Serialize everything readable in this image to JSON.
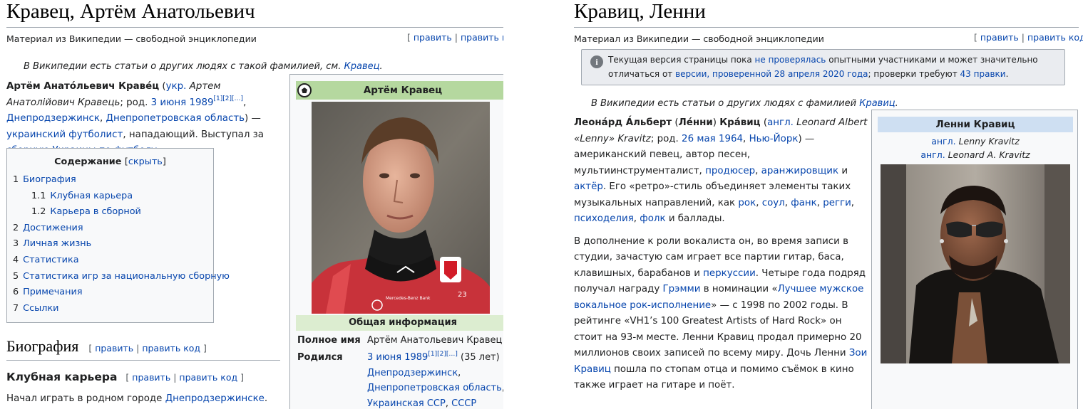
{
  "left": {
    "title": "Кравец, Артём Анатольевич",
    "site_sub": "Материал из Википедии — свободной энциклопедии",
    "edit": {
      "open": "[",
      "edit": "править",
      "sep": "|",
      "edit_code": "править код"
    },
    "hatnote": {
      "text": "В Википедии есть статьи о других людях с такой фамилией, см. ",
      "link": "Кравец",
      "end": "."
    },
    "lead": {
      "name_bold": "Артём Анато́льевич Краве́ц",
      "p1": " (",
      "lang_link": "укр.",
      "lang_native": " Артем Анатолійович Кравець",
      "p2": "; род. ",
      "date_link": "3 июня 1989",
      "refs": "[1][2][…]",
      "p3": ", ",
      "city_link": "Днепродзержинск",
      "p4": ", ",
      "region_link": "Днепропетровская область",
      "p5": ") — ",
      "occupation_link": "украинский футболист",
      "p6": ", нападающий. Выступал за ",
      "team_link": "сборную Украины по футболу",
      "p7": "."
    },
    "toc": {
      "title": "Содержание",
      "toggle_open": "[",
      "toggle": "скрыть",
      "toggle_close": "]",
      "items": [
        {
          "num": "1",
          "label": "Биография",
          "level": 1
        },
        {
          "num": "1.1",
          "label": "Клубная карьера",
          "level": 2
        },
        {
          "num": "1.2",
          "label": "Карьера в сборной",
          "level": 2
        },
        {
          "num": "2",
          "label": "Достижения",
          "level": 1
        },
        {
          "num": "3",
          "label": "Личная жизнь",
          "level": 1
        },
        {
          "num": "4",
          "label": "Статистика",
          "level": 1
        },
        {
          "num": "5",
          "label": "Статистика игр за национальную сборную",
          "level": 1
        },
        {
          "num": "6",
          "label": "Примечания",
          "level": 1
        },
        {
          "num": "7",
          "label": "Ссылки",
          "level": 1
        }
      ]
    },
    "h2": "Биография",
    "h3": "Клубная карьера",
    "section_edit": {
      "open": "[",
      "edit": "править",
      "sep": "|",
      "edit_code": "править код",
      "close": "]"
    },
    "body": {
      "text": "Начал играть в родном городе ",
      "link": "Днепродзержинске",
      "end": "."
    },
    "infobox": {
      "title": "Артём Кравец",
      "section": "Общая информация",
      "full_name_label": "Полное имя",
      "full_name_value": "Артём Анатольевич Кравец",
      "born_label": "Родился",
      "born_date": "3 июня 1989",
      "born_refs": "[1][2][…]",
      "born_age": " (35 лет)",
      "born_city": "Днепродзержинск",
      "born_region": "Днепропетровская область",
      "born_ssr": "Украинская ССР",
      "born_country": "СССР",
      "born_sep": ", ",
      "photo_sponsor": "Mercedes-Benz Bank",
      "photo_number": "23"
    }
  },
  "right": {
    "title": "Кравиц, Ленни",
    "site_sub": "Материал из Википедии — свободной энциклопедии",
    "edit": {
      "open": "[",
      "edit": "править",
      "sep": "|",
      "edit_code": "править код",
      "close": "]"
    },
    "notice": {
      "t1": "Текущая версия страницы пока ",
      "l1": "не проверялась",
      "t2": " опытными участниками и может значительно отличаться от ",
      "l2": "версии, проверенной 28 апреля 2020 года",
      "t3": "; проверки требуют ",
      "l3": "43 правки",
      "t4": "."
    },
    "hatnote": {
      "text": "В Википедии есть статьи о других людях с фамилией ",
      "link": "Кравиц",
      "end": "."
    },
    "lead": {
      "name_bold": "Леона́рд А́льберт",
      "nick_bold": "Ле́нни",
      "surname_bold": "Кра́виц",
      "lang_link": "англ.",
      "native": " Leonard Albert «Lenny» Kravitz",
      "born": "; род. ",
      "date_link": "26 мая 1964",
      "city_link": "Нью-Йорк",
      "t1": ") — американский певец, автор песен, мультиинструменталист, ",
      "producer_link": "продюсер",
      "arranger_link": "аранжировщик",
      "and": " и ",
      "actor_link": "актёр",
      "t2": ". Его «ретро»-стиль объединяет элементы таких музыкальных направлений, как ",
      "genres": [
        "рок",
        "соул",
        "фанк",
        "регги",
        "психоделия",
        "фолк"
      ],
      "t3": " и баллады.",
      "p2_1": "В дополнение к роли вокалиста он, во время записи в студии, зачастую сам играет все партии гитар, баса, клавишных, барабанов и ",
      "perc_link": "перкуссии",
      "p2_2": ". Четыре года подряд получал награду ",
      "grammy_link": "Грэмми",
      "p2_3": " в номинации «",
      "award_link": "Лучшее мужское вокальное рок-исполнение",
      "p2_4": "» — с 1998 по 2002 годы. В рейтинге «VH1’s 100 Greatest Artists of Hard Rock» он стоит на 93-м месте. Ленни Кравиц продал примерно 20 миллионов своих записей по всему миру. Дочь Ленни ",
      "zoe_link": "Зои Кравиц",
      "p2_5": " пошла по стопам отца и помимо съёмок в кино также играет на гитаре и поёт."
    },
    "infobox": {
      "title": "Ленни Кравиц",
      "sub1_link": "англ.",
      "sub1_text": " Lenny Kravitz",
      "sub2_link": "англ.",
      "sub2_text": " Leonard A. Kravitz"
    }
  }
}
